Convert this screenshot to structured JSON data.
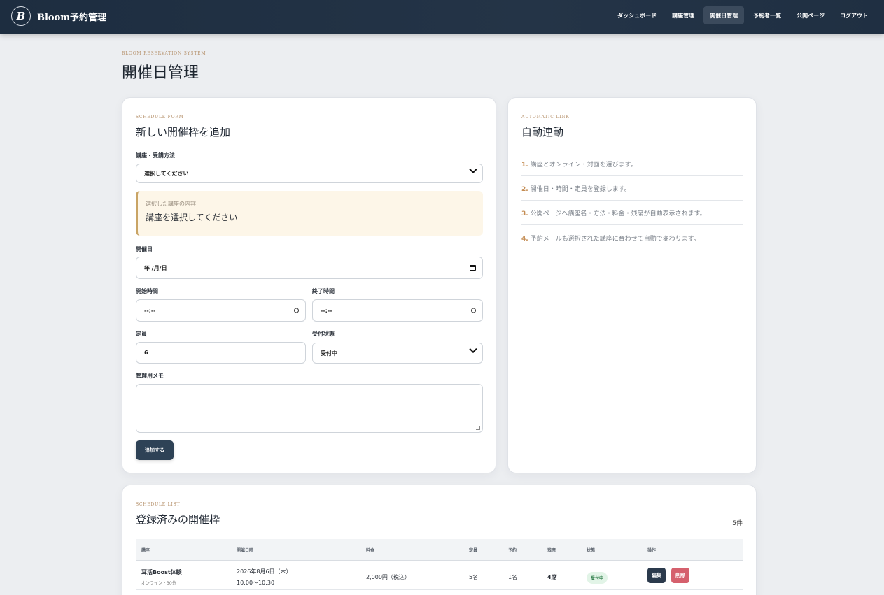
{
  "header": {
    "brand_initial": "B",
    "brand_name": "Bloom予約管理",
    "nav": [
      {
        "label": "ダッシュボード",
        "active": false
      },
      {
        "label": "講座管理",
        "active": false
      },
      {
        "label": "開催日管理",
        "active": true
      },
      {
        "label": "予約者一覧",
        "active": false
      },
      {
        "label": "公開ページ",
        "active": false
      },
      {
        "label": "ログアウト",
        "active": false
      }
    ]
  },
  "page": {
    "eyebrow": "BLOOM RESERVATION SYSTEM",
    "title": "開催日管理"
  },
  "form": {
    "eyebrow": "SCHEDULE FORM",
    "title": "新しい開催枠を追加",
    "course_label": "講座・受講方法",
    "course_value": "選択してください",
    "preview_label": "選択した講座の内容",
    "preview_text": "講座を選択してください",
    "date_label": "開催日",
    "date_value": "年 /月/日",
    "start_label": "開始時間",
    "start_value": "--:--",
    "end_label": "終了時間",
    "end_value": "--:--",
    "capacity_label": "定員",
    "capacity_value": "6",
    "status_label": "受付状態",
    "status_value": "受付中",
    "memo_label": "管理用メモ",
    "memo_value": "",
    "submit_label": "追加する"
  },
  "automatic": {
    "eyebrow": "AUTOMATIC LINK",
    "title": "自動連動",
    "steps": [
      {
        "num": "1.",
        "text": "講座とオンライン・対面を選びます。"
      },
      {
        "num": "2.",
        "text": "開催日・時間・定員を登録します。"
      },
      {
        "num": "3.",
        "text": "公開ページへ講座名・方法・料金・残席が自動表示されます。"
      },
      {
        "num": "4.",
        "text": "予約メールも選択された講座に合わせて自動で変わります。"
      }
    ]
  },
  "list": {
    "eyebrow": "SCHEDULE LIST",
    "title": "登録済みの開催枠",
    "count": "5件",
    "columns": [
      "講座",
      "開催日時",
      "料金",
      "定員",
      "予約",
      "残席",
      "状態",
      "操作"
    ],
    "rows": [
      {
        "course": "耳活Boost体験",
        "course_sub": "オンライン・30分",
        "date": "2026年8月6日（木）",
        "time": "10:00〜10:30",
        "price": "2,000円（税込）",
        "capacity": "5名",
        "booked": "1名",
        "remaining": "4席",
        "status": "受付中",
        "edit_label": "編集",
        "delete_label": "削除"
      }
    ]
  }
}
